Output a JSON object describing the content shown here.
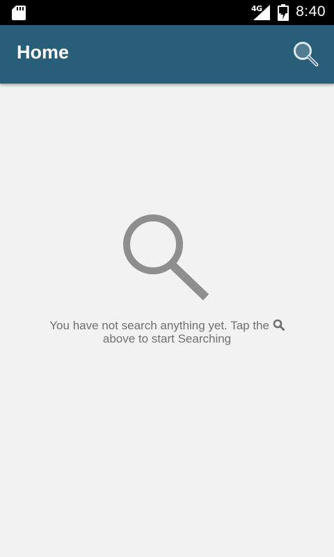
{
  "status_bar": {
    "network": "4G",
    "time": "8:40",
    "icons": [
      "sd-card-icon",
      "signal-icon",
      "battery-charging-icon"
    ]
  },
  "app_bar": {
    "title": "Home",
    "action_icon": "search-icon",
    "color": "#285e78"
  },
  "empty_state": {
    "icon": "search-icon",
    "message_part1": "You have not search anything yet. Tap the",
    "inline_icon": "search-icon",
    "message_part2": "above to start Searching",
    "text_color": "#6f6f6f",
    "icon_color": "#8e8e8e"
  },
  "background_color": "#f2f2f2"
}
